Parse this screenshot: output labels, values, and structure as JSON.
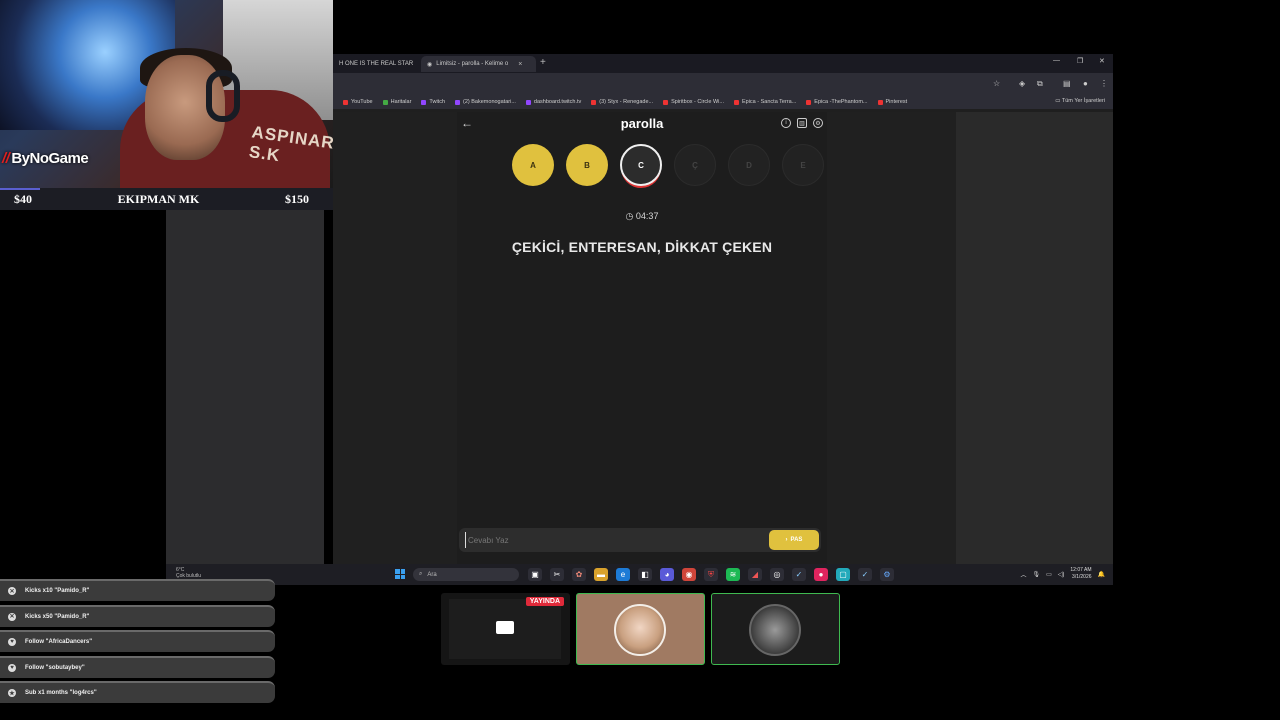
{
  "stream": {
    "brand": "ByNoGame",
    "jersey_text": "ASPINAR S.K",
    "price_left": "$40",
    "price_center": "EKIPMAN MK",
    "price_right": "$150"
  },
  "browser": {
    "tabs": [
      {
        "label": "H ONE IS THE REAL STAR",
        "close": "×"
      },
      {
        "label": "Limitsiz - parolla - Kelime o",
        "close": "×"
      }
    ],
    "new_tab": "+",
    "bookmarks": [
      {
        "label": "YouTube",
        "color": "#e33"
      },
      {
        "label": "Haritalar",
        "color": "#4a4"
      },
      {
        "label": "Twitch",
        "color": "#9146ff"
      },
      {
        "label": "(2) Bakemonogatari...",
        "color": "#9146ff"
      },
      {
        "label": "dashboard.twitch.tv",
        "color": "#9146ff"
      },
      {
        "label": "(3) Styx - Renegade...",
        "color": "#e33"
      },
      {
        "label": "Spiritbox - Circle Wi...",
        "color": "#e33"
      },
      {
        "label": "Epica - Sancta Terra...",
        "color": "#e33"
      },
      {
        "label": "Epica -ThePhantom...",
        "color": "#e33"
      },
      {
        "label": "Pinterest",
        "color": "#e33"
      }
    ],
    "bookmarks_all": "Tüm Yer İşaretleri"
  },
  "game": {
    "title": "parolla",
    "back_icon": "arrow-left-icon",
    "letters": [
      {
        "char": "A",
        "state": "done"
      },
      {
        "char": "B",
        "state": "done"
      },
      {
        "char": "C",
        "state": "current"
      },
      {
        "char": "Ç",
        "state": "todo"
      },
      {
        "char": "D",
        "state": "todo"
      },
      {
        "char": "E",
        "state": "todo"
      }
    ],
    "timer": "04:37",
    "clue": "ÇEKİCİ, ENTERESAN, DİKKAT ÇEKEN",
    "answer_placeholder": "Cevabı Yaz",
    "pass_label": "PAS",
    "accent_color": "#e0c13e"
  },
  "taskbar": {
    "weather_temp": "6°C",
    "weather_desc": "Çok bulutlu",
    "search_label": "Ara",
    "time": "12:07 AM",
    "date": "3/1/2026"
  },
  "alerts": [
    {
      "text": "Kicks x10 \"Pamido_R\"",
      "icon": "close-icon"
    },
    {
      "text": "Kicks x50 \"Pamido_R\"",
      "icon": "close-icon"
    },
    {
      "text": "Follow \"AfricaDancers\"",
      "icon": "heart-icon"
    },
    {
      "text": "Follow \"sobutaybey\"",
      "icon": "heart-icon"
    },
    {
      "text": "Sub x1 months \"log4rcs\"",
      "icon": "star-icon"
    }
  ],
  "guests": {
    "live_badge": "YAYINDA"
  }
}
